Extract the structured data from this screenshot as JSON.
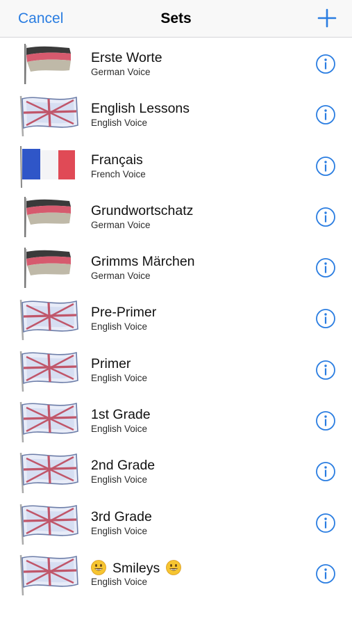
{
  "navbar": {
    "cancel_label": "Cancel",
    "title": "Sets",
    "add_icon": "plus-icon"
  },
  "colors": {
    "accent": "#2a7de1",
    "navbar_bg": "#f8f8f8"
  },
  "sets": [
    {
      "title": "Erste Worte",
      "subtitle": "German Voice",
      "flag": "german-flag-icon"
    },
    {
      "title": "English Lessons",
      "subtitle": "English Voice",
      "flag": "uk-flag-icon"
    },
    {
      "title": "Français",
      "subtitle": "French Voice",
      "flag": "french-flag-icon"
    },
    {
      "title": "Grundwortschatz",
      "subtitle": "German Voice",
      "flag": "german-flag-icon"
    },
    {
      "title": "Grimms Märchen",
      "subtitle": "German Voice",
      "flag": "german-flag-icon"
    },
    {
      "title": "Pre-Primer",
      "subtitle": "English Voice",
      "flag": "uk-flag-icon"
    },
    {
      "title": "Primer",
      "subtitle": "English Voice",
      "flag": "uk-flag-icon"
    },
    {
      "title": "1st Grade",
      "subtitle": "English Voice",
      "flag": "uk-flag-icon"
    },
    {
      "title": "2nd Grade",
      "subtitle": "English Voice",
      "flag": "uk-flag-icon"
    },
    {
      "title": "3rd Grade",
      "subtitle": "English Voice",
      "flag": "uk-flag-icon"
    },
    {
      "title": "Smileys",
      "subtitle": "English Voice",
      "flag": "uk-flag-icon",
      "emoji": "smiley-emoji-icon"
    }
  ],
  "info_icon": "info-icon"
}
